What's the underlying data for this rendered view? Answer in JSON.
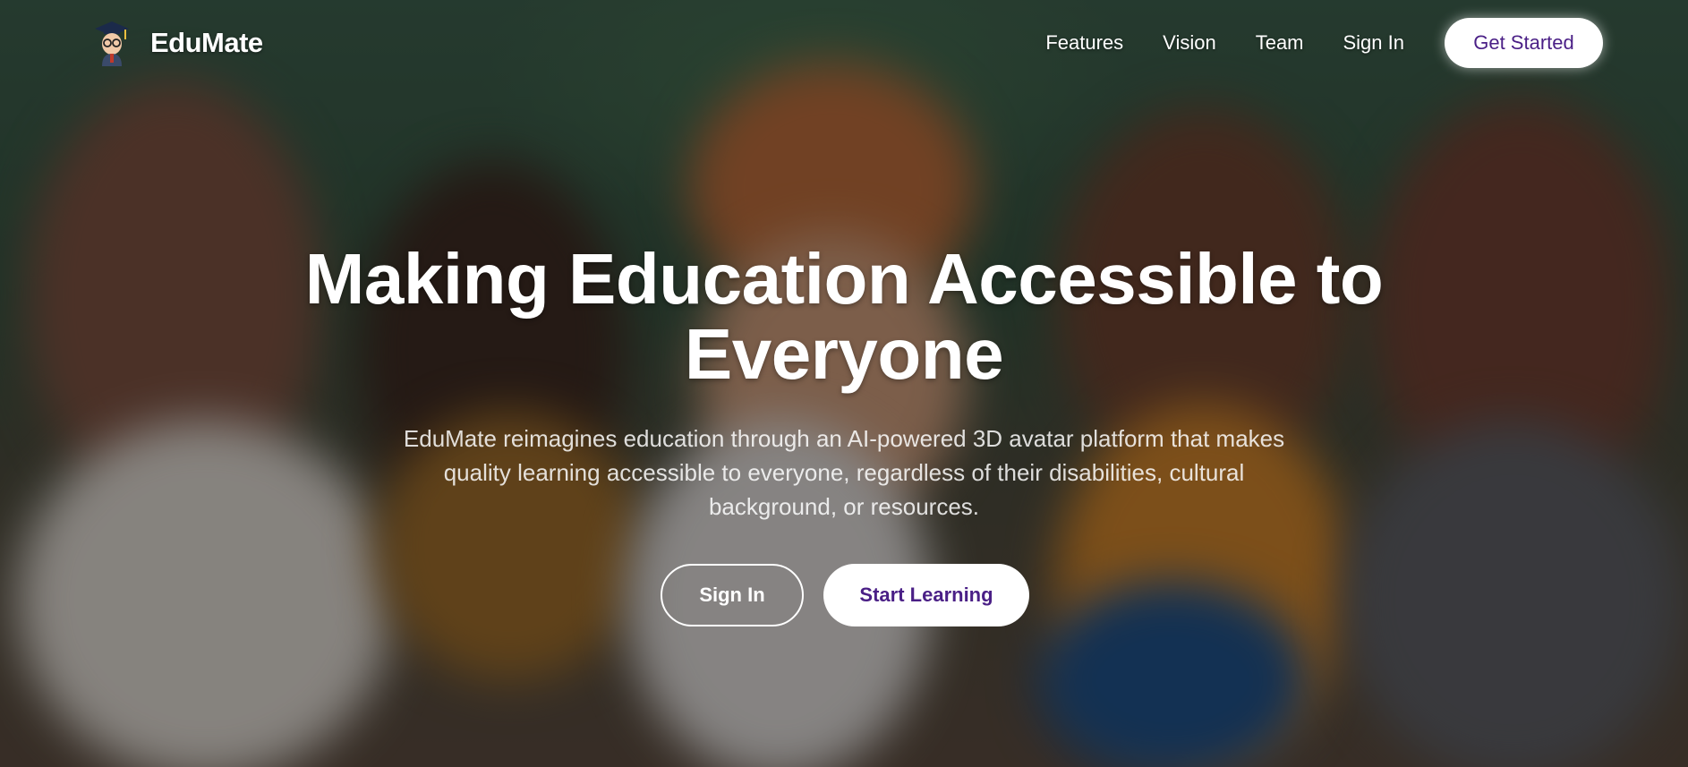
{
  "brand": {
    "name": "EduMate",
    "logo_icon": "graduate-avatar-icon"
  },
  "nav": {
    "links": [
      "Features",
      "Vision",
      "Team",
      "Sign In"
    ],
    "cta_label": "Get Started"
  },
  "hero": {
    "headline": "Making Education Accessible to Everyone",
    "subtext": "EduMate reimagines education through an AI-powered 3D avatar platform that makes quality learning accessible to everyone, regardless of their disabilities, cultural background, or resources.",
    "primary_outline_label": "Sign In",
    "primary_solid_label": "Start Learning",
    "background_image": "blurred-classroom-students-photo"
  },
  "colors": {
    "accent": "#4a1f86",
    "text": "#ffffff"
  }
}
